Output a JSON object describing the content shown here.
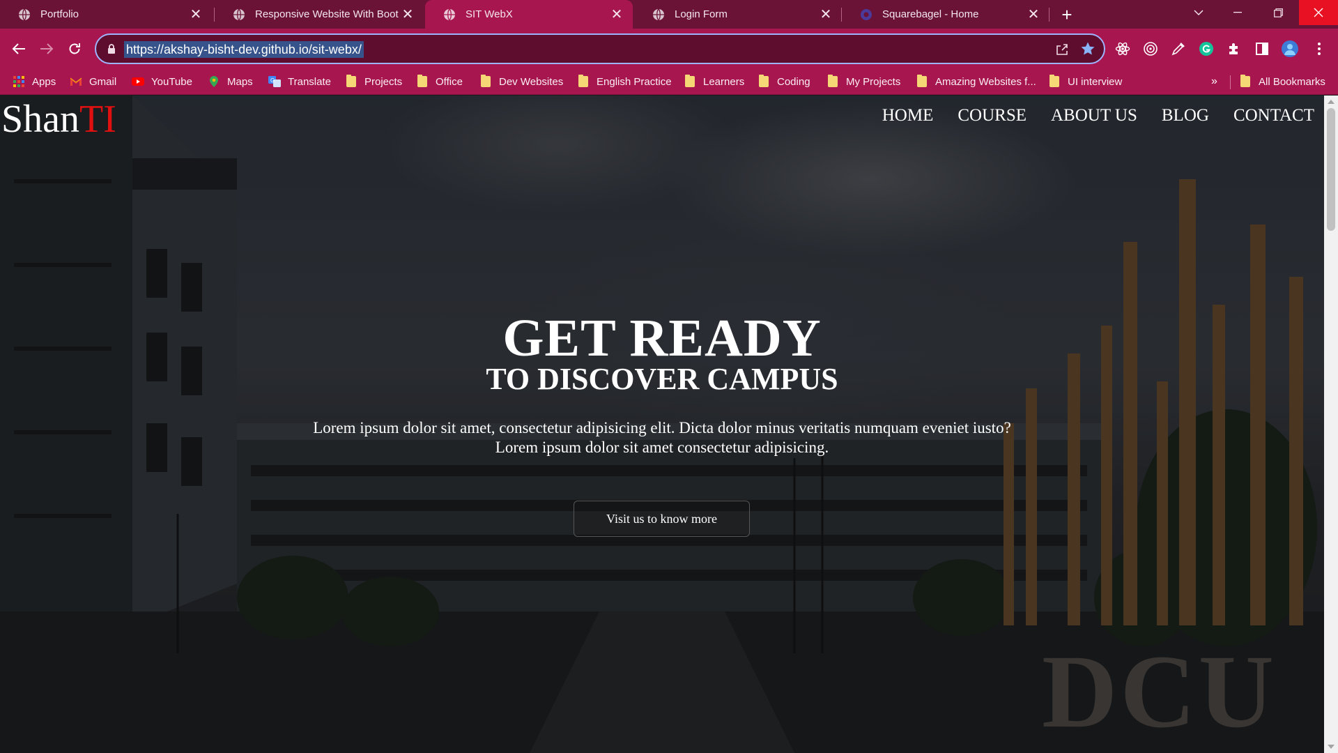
{
  "browser": {
    "tabs": [
      {
        "label": "Portfolio",
        "active": false
      },
      {
        "label": "Responsive Website With Bootst",
        "active": false
      },
      {
        "label": "SIT WebX",
        "active": true
      },
      {
        "label": "Login Form",
        "active": false
      },
      {
        "label": "Squarebagel - Home",
        "active": false
      }
    ],
    "url": "https://akshay-bisht-dev.github.io/sit-webx/",
    "bookmarks": [
      {
        "label": "Apps",
        "icon": "apps-grid-icon"
      },
      {
        "label": "Gmail",
        "icon": "gmail-icon"
      },
      {
        "label": "YouTube",
        "icon": "youtube-icon"
      },
      {
        "label": "Maps",
        "icon": "maps-icon"
      },
      {
        "label": "Translate",
        "icon": "translate-icon"
      },
      {
        "label": "Projects",
        "icon": "folder-icon"
      },
      {
        "label": "Office",
        "icon": "folder-icon"
      },
      {
        "label": "Dev Websites",
        "icon": "folder-icon"
      },
      {
        "label": "English Practice",
        "icon": "folder-icon"
      },
      {
        "label": "Learners",
        "icon": "folder-icon"
      },
      {
        "label": "Coding",
        "icon": "folder-icon"
      },
      {
        "label": "My Projects",
        "icon": "folder-icon"
      },
      {
        "label": "Amazing Websites f...",
        "icon": "folder-icon"
      },
      {
        "label": "UI interview",
        "icon": "folder-icon"
      }
    ],
    "bookmarks_more": "»",
    "all_bookmarks": "All Bookmarks",
    "theme_colors": {
      "tabstrip": "#6b1237",
      "toolbar": "#a8164f",
      "omnibox": "#5e0d2e"
    }
  },
  "site": {
    "logo_main": "Shan",
    "logo_accent": "TI",
    "logo_accent_color": "#e01010",
    "nav": [
      "HOME",
      "COURSE",
      "ABOUT US",
      "BLOG",
      "CONTACT"
    ],
    "hero_title": "GET READY",
    "hero_subtitle": "TO DISCOVER CAMPUS",
    "hero_text_line1": "Lorem ipsum dolor sit amet, consectetur adipisicing elit. Dicta dolor minus veritatis numquam eveniet iusto?",
    "hero_text_line2": "Lorem ipsum dolor sit amet consectetur adipisicing.",
    "hero_button": "Visit us to know more",
    "background_sign": "DCU"
  }
}
